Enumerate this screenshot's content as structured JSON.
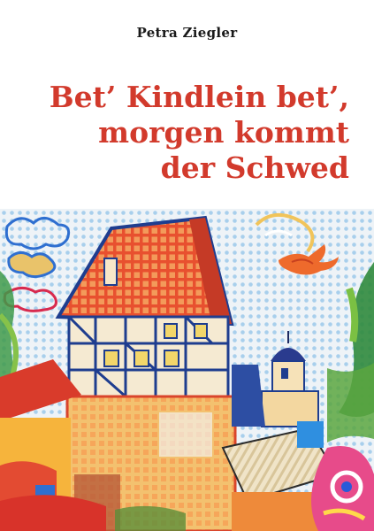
{
  "book": {
    "author": "Petra Ziegler",
    "title_lines": [
      "Bet’ Kindlein bet’,",
      "morgen kommt",
      "der Schwed"
    ]
  },
  "colors": {
    "title": "#d23a2c",
    "author": "#1a1a1a",
    "background": "#ffffff"
  },
  "artwork": {
    "subject": "watercolor painting of half-timbered town house with red tiled roof and church tower",
    "icons": [
      "house-painting",
      "tower-painting",
      "bird-painting",
      "cloud-painting"
    ]
  }
}
